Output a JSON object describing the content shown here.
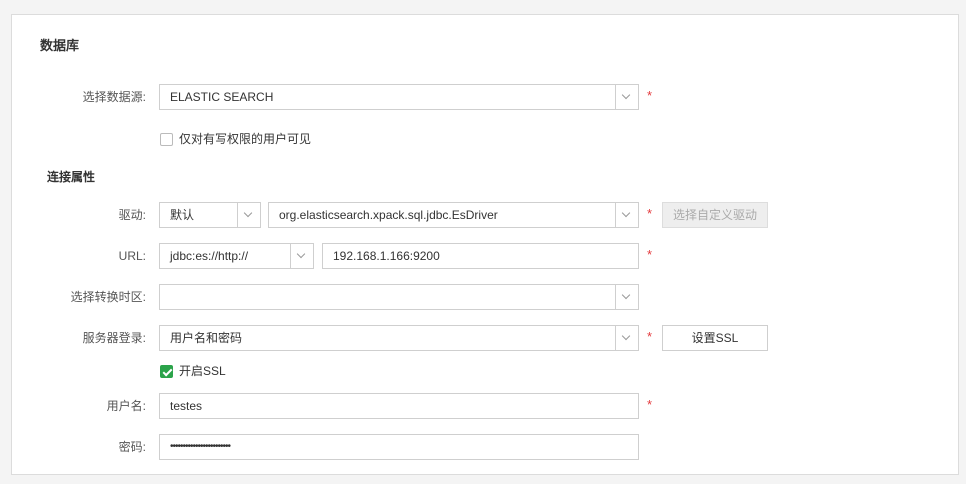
{
  "section": {
    "title": "数据库"
  },
  "datasource": {
    "label": "选择数据源:",
    "value": "ELASTIC SEARCH",
    "required": "*"
  },
  "permission": {
    "label": "仅对有写权限的用户可见",
    "checked": false
  },
  "connection": {
    "title": "连接属性"
  },
  "driver": {
    "label": "驱动:",
    "type_value": "默认",
    "class_value": "org.elasticsearch.xpack.sql.jdbc.EsDriver",
    "required": "*",
    "custom_button": "选择自定义驱动"
  },
  "url": {
    "label": "URL:",
    "prefix_value": "jdbc:es://http://",
    "host_value": "192.168.1.166:9200",
    "required": "*"
  },
  "timezone": {
    "label": "选择转换时区:",
    "value": ""
  },
  "login": {
    "label": "服务器登录:",
    "value": "用户名和密码",
    "required": "*",
    "ssl_button": "设置SSL"
  },
  "ssl": {
    "label": "开启SSL",
    "checked": true
  },
  "username": {
    "label": "用户名:",
    "value": "testes",
    "required": "*"
  },
  "password": {
    "label": "密码:",
    "value": "••••••••••••••••••••••••"
  },
  "colors": {
    "required": "#e4393c",
    "checkbox_checked": "#2ba34a",
    "border": "#cfcfcf"
  }
}
